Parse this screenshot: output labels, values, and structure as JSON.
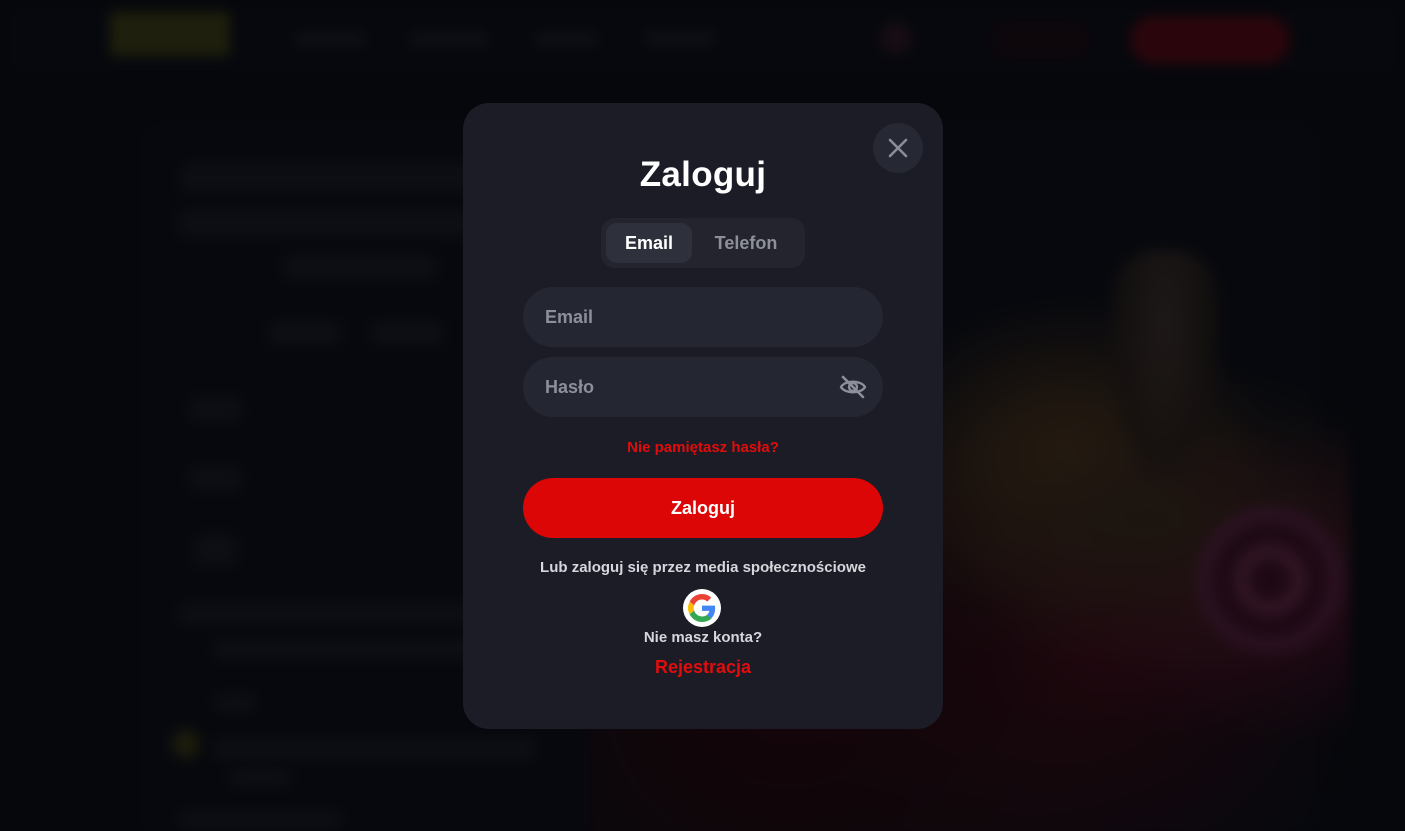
{
  "modal": {
    "title": "Zaloguj",
    "tabs": [
      {
        "label": "Email",
        "active": true
      },
      {
        "label": "Telefon",
        "active": false
      }
    ],
    "email_field": {
      "placeholder": "Email",
      "value": ""
    },
    "password_field": {
      "placeholder": "Hasło",
      "value": ""
    },
    "forgot_password": "Nie pamiętasz hasła?",
    "login_button": "Zaloguj",
    "social_text": "Lub zaloguj się przez media społecznościowe",
    "no_account": "Nie masz konta?",
    "register_link": "Rejestracja",
    "icons": {
      "close": "close-icon",
      "eye": "eye-off-icon",
      "google": "google-icon"
    }
  },
  "colors": {
    "accent_red": "#dd0606",
    "link_red": "#e10d0d",
    "modal_bg": "#1b1c25",
    "field_bg": "#242631"
  }
}
